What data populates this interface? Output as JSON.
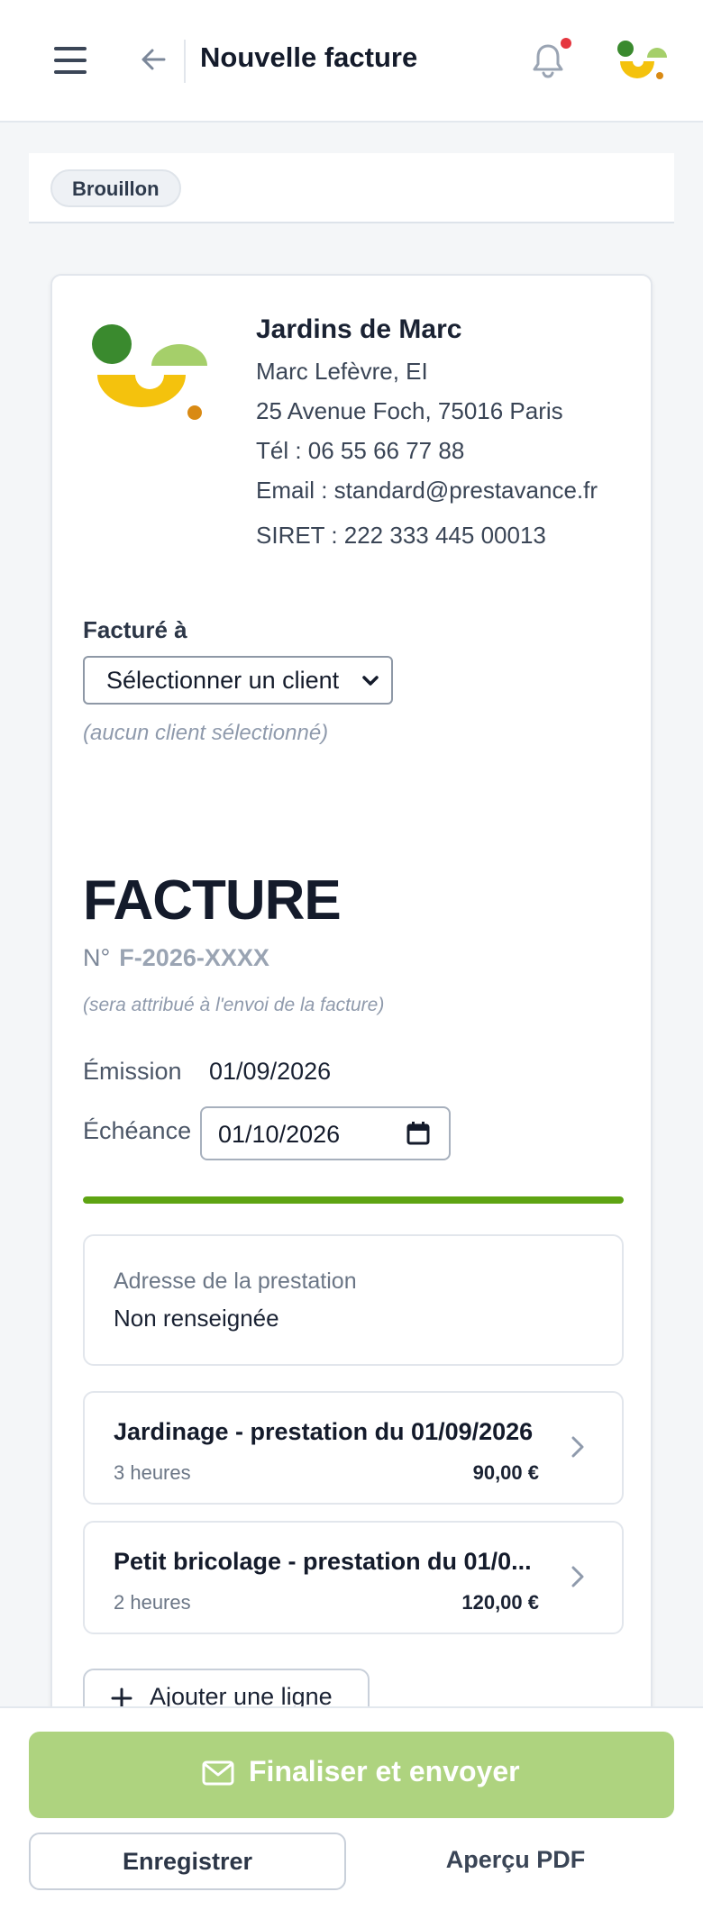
{
  "header": {
    "title": "Nouvelle facture",
    "icons": {
      "menu": "hamburger-icon",
      "back": "arrow-left-icon",
      "notifications": "bell-icon",
      "avatar": "brand-logo"
    },
    "has_unread_notification": true
  },
  "status": {
    "badge": "Brouillon"
  },
  "company": {
    "name": "Jardins de Marc",
    "owner": "Marc Lefèvre, EI",
    "address": "25 Avenue Foch, 75016 Paris",
    "phone": "Tél : 06 55 66 77 88",
    "email": "Email : standard@prestavance.fr",
    "siret": "SIRET : 222 333 445 00013"
  },
  "billing": {
    "label": "Facturé à",
    "select_value": "Sélectionner un client",
    "empty_note": "(aucun client sélectionné)"
  },
  "invoice": {
    "heading": "FACTURE",
    "number_prefix": "N°",
    "number": "F-2026-XXXX",
    "number_note": "(sera attribué à l'envoi de la facture)",
    "emission_label": "Émission",
    "emission_date": "01/09/2026",
    "due_label": "Échéance",
    "due_date": "01/10/2026",
    "progress_fraction": 1.0
  },
  "service_address": {
    "label": "Adresse de la prestation",
    "value": "Non renseignée"
  },
  "lines": [
    {
      "title": "Jardinage - prestation du 01/09/2026",
      "quantity": "3 heures",
      "price": "90,00 €"
    },
    {
      "title": "Petit bricolage - prestation du 01/0...",
      "quantity": "2 heures",
      "price": "120,00 €"
    }
  ],
  "add_line_label": "Ajouter une ligne",
  "actions": {
    "finalize": "Finaliser et envoyer",
    "save": "Enregistrer",
    "pdf": "Aperçu PDF"
  },
  "colors": {
    "accent_green": "#5ea412",
    "finalize_bg": "#aed37f",
    "notif_red": "#e5363f"
  }
}
